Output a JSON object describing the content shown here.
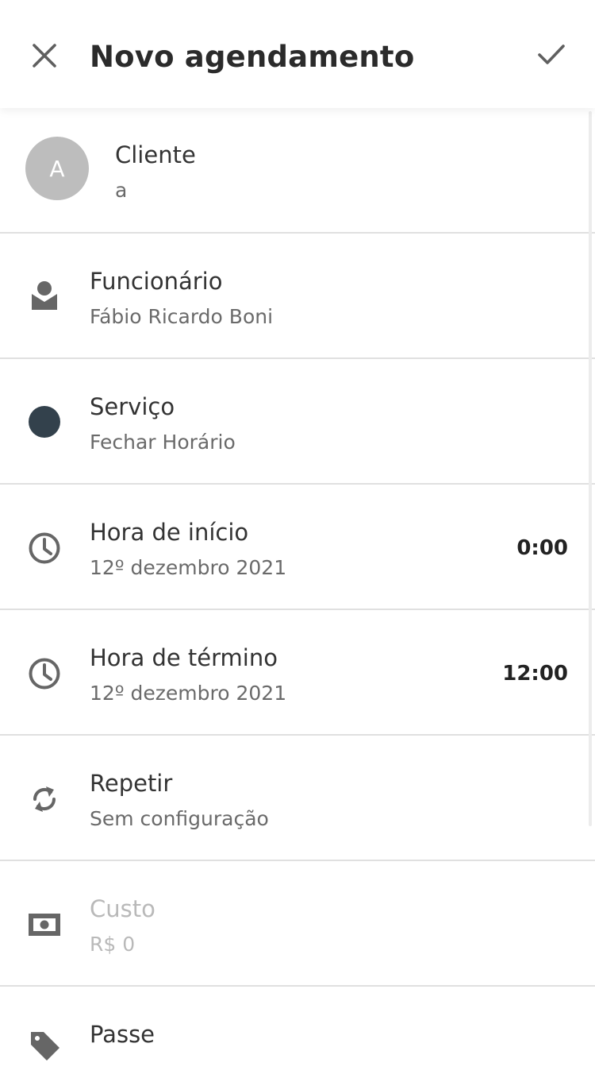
{
  "header": {
    "title": "Novo agendamento",
    "close_icon": "close-icon",
    "confirm_icon": "check-icon"
  },
  "client": {
    "avatar_letter": "A",
    "label": "Cliente",
    "value": "a"
  },
  "rows": {
    "employee": {
      "label": "Funcionário",
      "value": "Fábio Ricardo Boni",
      "icon": "person-icon"
    },
    "service": {
      "label": "Serviço",
      "value": "Fechar Horário",
      "icon": "color-dot-icon",
      "color": "#33414c"
    },
    "start": {
      "label": "Hora de início",
      "date": "12º dezembro 2021",
      "time": "0:00",
      "icon": "clock-icon"
    },
    "end": {
      "label": "Hora de término",
      "date": "12º dezembro 2021",
      "time": "12:00",
      "icon": "clock-icon"
    },
    "repeat": {
      "label": "Repetir",
      "value": "Sem configuração",
      "icon": "repeat-icon"
    },
    "cost": {
      "label": "Custo",
      "value": "R$ 0",
      "icon": "money-icon"
    },
    "pass": {
      "label": "Passe",
      "icon": "tag-icon"
    }
  },
  "colors": {
    "divider": "#e0e0e0",
    "icon": "#666666",
    "service_dot": "#33414c",
    "muted_text": "#b9b9b9"
  }
}
